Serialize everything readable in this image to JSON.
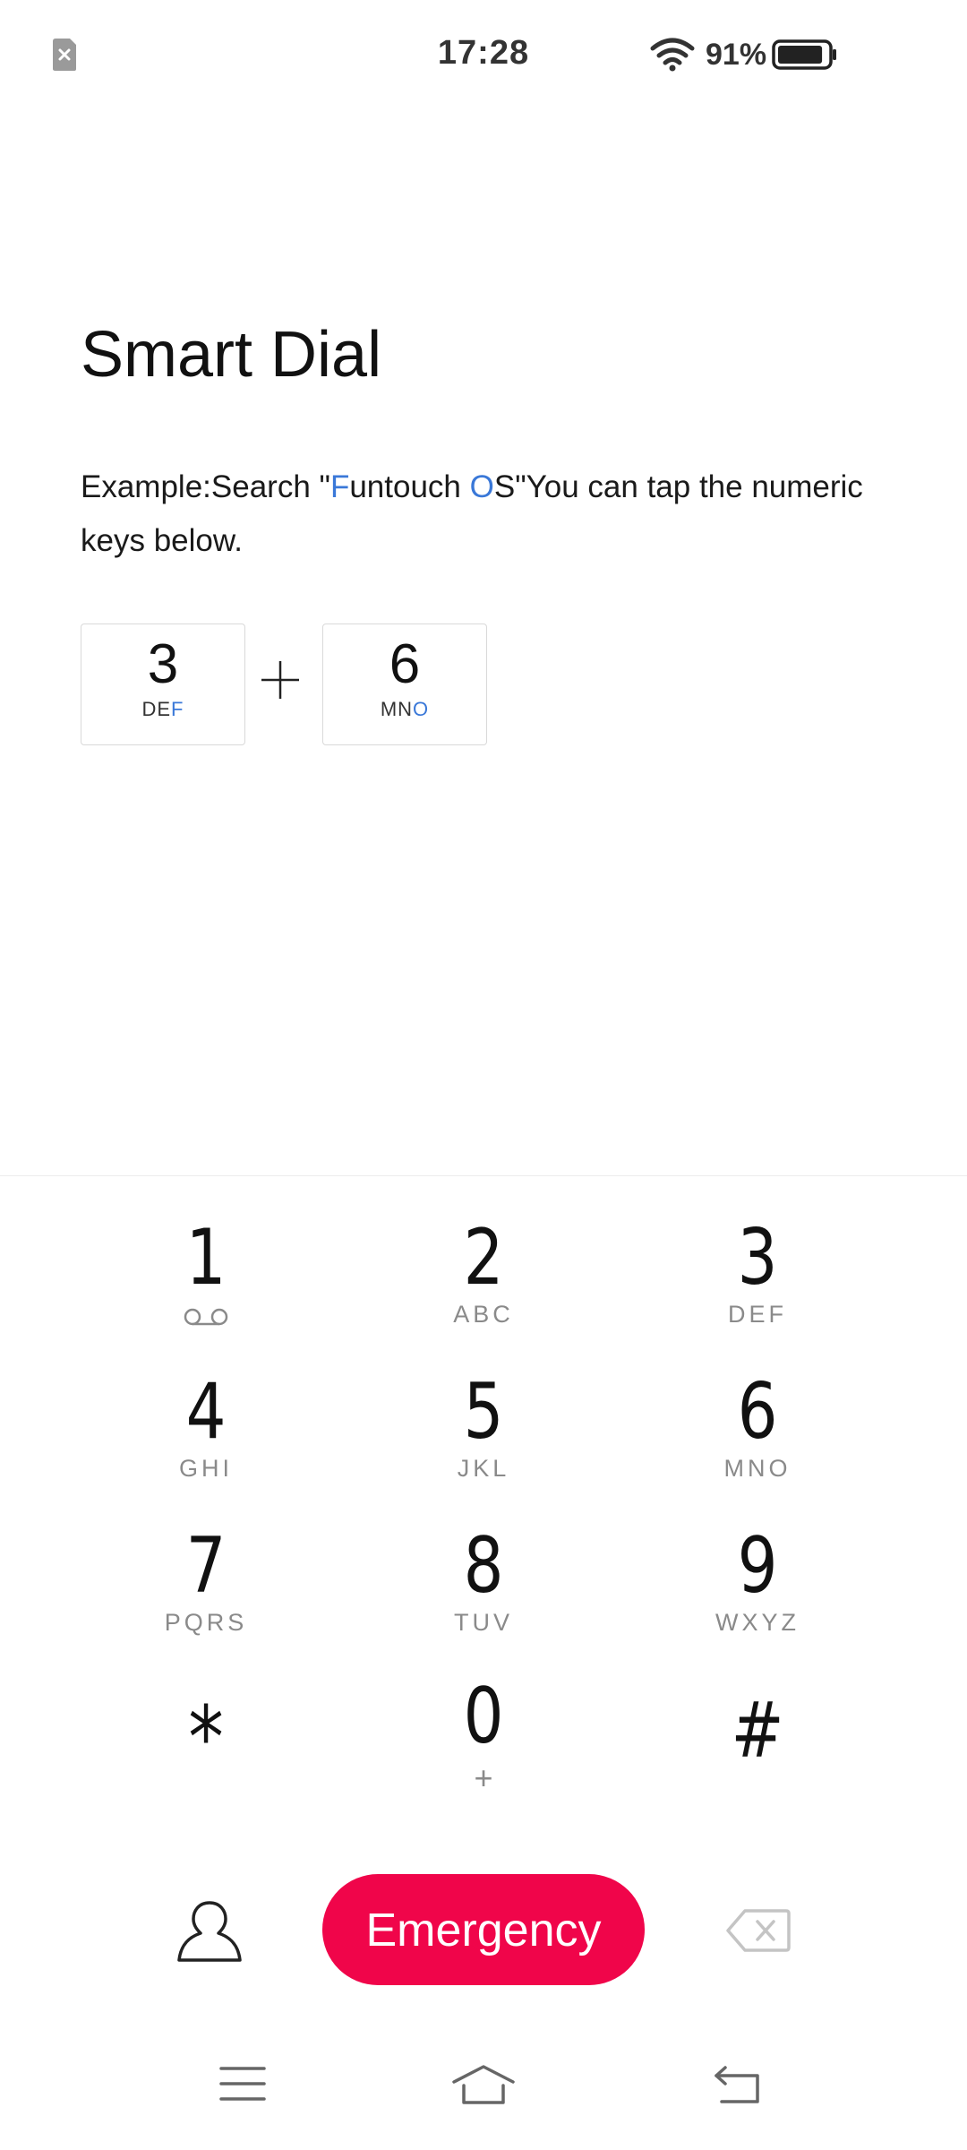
{
  "status_bar": {
    "time": "17:28",
    "battery_percent": "91%",
    "battery_level": 0.91,
    "icons": [
      "sim-absent-icon",
      "wifi-icon",
      "battery-icon"
    ]
  },
  "smart_dial": {
    "title": "Smart Dial",
    "example": {
      "prefix": "Example:Search \"",
      "hl1": "F",
      "mid": "untouch ",
      "hl2": "O",
      "suffix": "S\"You can tap the numeric keys below."
    },
    "demo_keys": [
      {
        "num": "3",
        "letters_plain": "DE",
        "letters_highlight": "F"
      },
      {
        "num": "6",
        "letters_plain": "MN",
        "letters_highlight": "O"
      }
    ],
    "plus_icon": "plus-icon"
  },
  "dialpad": {
    "keys": [
      {
        "num": "1",
        "letters": "",
        "icon": "voicemail-icon"
      },
      {
        "num": "2",
        "letters": "ABC"
      },
      {
        "num": "3",
        "letters": "DEF"
      },
      {
        "num": "4",
        "letters": "GHI"
      },
      {
        "num": "5",
        "letters": "JKL"
      },
      {
        "num": "6",
        "letters": "MNO"
      },
      {
        "num": "7",
        "letters": "PQRS"
      },
      {
        "num": "8",
        "letters": "TUV"
      },
      {
        "num": "9",
        "letters": "WXYZ"
      },
      {
        "num": "*",
        "letters": ""
      },
      {
        "num": "0",
        "letters": "+"
      },
      {
        "num": "#",
        "letters": ""
      }
    ]
  },
  "actions": {
    "emergency_label": "Emergency",
    "emergency_color": "#f0054a",
    "left_icon": "contacts-icon",
    "right_icon": "backspace-icon"
  },
  "nav_bar": {
    "icons": [
      "menu-icon",
      "home-icon",
      "back-icon"
    ]
  }
}
